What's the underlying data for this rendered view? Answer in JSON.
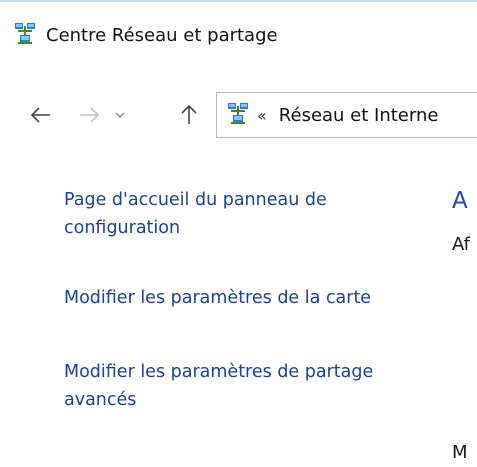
{
  "window": {
    "title": "Centre Réseau et partage",
    "title_icon": "network-icon"
  },
  "nav": {
    "back_icon": "arrow-left-icon",
    "forward_icon": "arrow-right-icon",
    "recent_icon": "chevron-down-icon",
    "up_icon": "arrow-up-icon",
    "address": {
      "icon": "network-icon",
      "separator": "«",
      "crumb": "Réseau et Interne"
    }
  },
  "sidebar": {
    "items": [
      {
        "label": "Page d'accueil du panneau de configuration"
      },
      {
        "label": "Modifier les paramètres de la carte"
      },
      {
        "label": "Modifier les paramètres de partage avancés"
      }
    ]
  },
  "main": {
    "heading": "A",
    "line1": "Af",
    "line2": "M"
  },
  "colors": {
    "link": "#1c3f97",
    "heading": "#1f4fa3",
    "accent": "#c7dff5"
  }
}
